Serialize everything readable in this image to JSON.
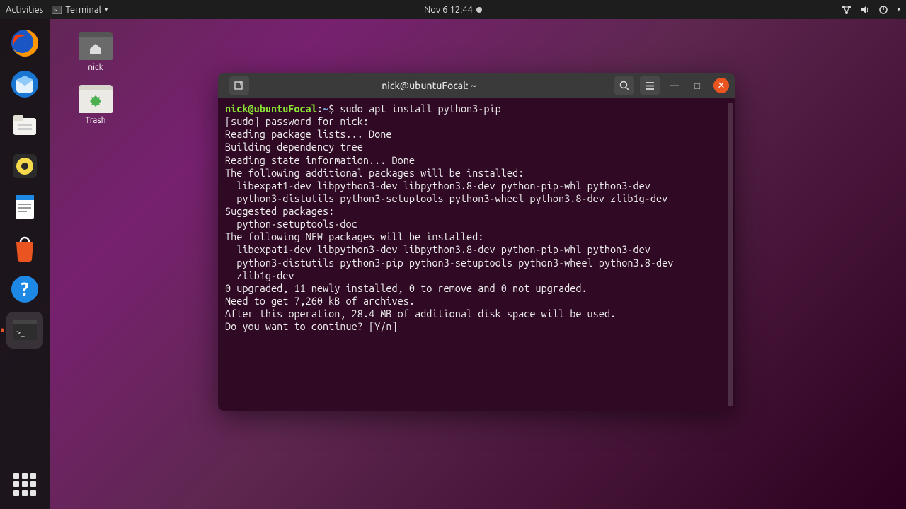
{
  "topbar": {
    "activities": "Activities",
    "app_label": "Terminal",
    "clock": "Nov 6  12:44"
  },
  "desktop": {
    "home_label": "nick",
    "trash_label": "Trash"
  },
  "terminal": {
    "title": "nick@ubuntuFocal: ~",
    "prompt_user": "nick@ubuntuFocal",
    "prompt_path": "~",
    "prompt_symbol": "$",
    "command": "sudo apt install python3-pip",
    "output": "[sudo] password for nick:\nReading package lists... Done\nBuilding dependency tree\nReading state information... Done\nThe following additional packages will be installed:\n  libexpat1-dev libpython3-dev libpython3.8-dev python-pip-whl python3-dev\n  python3-distutils python3-setuptools python3-wheel python3.8-dev zlib1g-dev\nSuggested packages:\n  python-setuptools-doc\nThe following NEW packages will be installed:\n  libexpat1-dev libpython3-dev libpython3.8-dev python-pip-whl python3-dev\n  python3-distutils python3-pip python3-setuptools python3-wheel python3.8-dev\n  zlib1g-dev\n0 upgraded, 11 newly installed, 0 to remove and 0 not upgraded.\nNeed to get 7,260 kB of archives.\nAfter this operation, 28.4 MB of additional disk space will be used.\nDo you want to continue? [Y/n] "
  }
}
